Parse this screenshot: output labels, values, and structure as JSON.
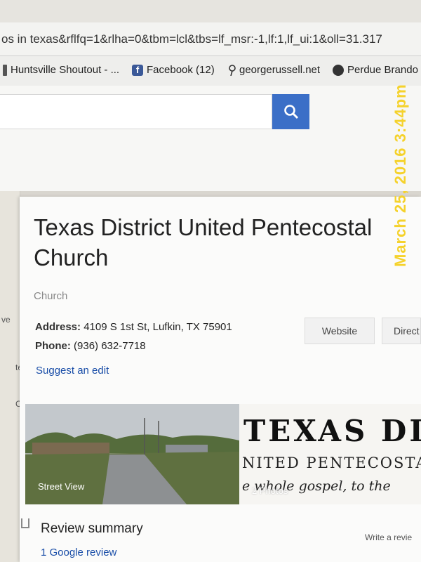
{
  "browser": {
    "url_fragment": "os in texas&rflfq=1&rlha=0&tbm=lcl&tbs=lf_msr:-1,lf:1,lf_ui:1&oll=31.317",
    "bookmarks": [
      {
        "label": "Huntsville Shoutout - ...",
        "icon": "bookmark-icon"
      },
      {
        "label": "Facebook (12)",
        "icon": "facebook-icon"
      },
      {
        "label": "georgerussell.net",
        "icon": "pin-icon"
      },
      {
        "label": "Perdue Brando",
        "icon": "globe-icon"
      }
    ]
  },
  "search": {
    "button_icon": "search-icon",
    "button_color": "#3b6fc7"
  },
  "watermark": "March 25, 2016 3:44pm",
  "map": {
    "labels": [
      "ve",
      "te",
      "C"
    ]
  },
  "place": {
    "title": "Texas District United Pentecostal Church",
    "category": "Church",
    "address_label": "Address:",
    "address": "4109 S 1st St, Lufkin, TX 75901",
    "phone_label": "Phone:",
    "phone": "(936) 632-7718",
    "website_button": "Website",
    "directions_button": "Direct",
    "suggest_edit": "Suggest an edit"
  },
  "photos": {
    "street_view_label": "Street View",
    "photos_count": "2 Photos",
    "logo_line1": "TEXAS DIS",
    "logo_line2": "NITED PENTECOSTA",
    "logo_line3": "e whole gospel, to the"
  },
  "reviews": {
    "title": "Review summary",
    "count": "1 Google review",
    "write_review": "Write a revie"
  }
}
